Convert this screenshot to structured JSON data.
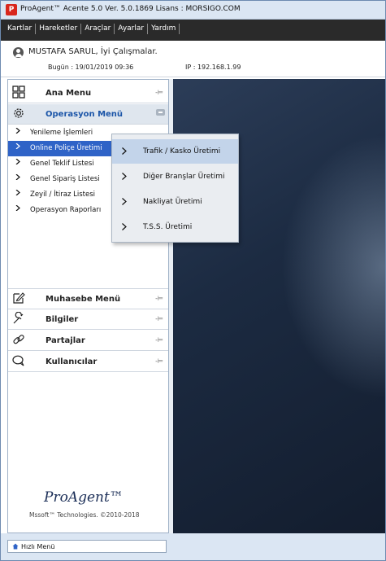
{
  "window": {
    "title": "ProAgent™ Acente 5.0  Ver. 5.0.1869    Lisans : MORSIGO.COM"
  },
  "menu": {
    "items": [
      "Kartlar",
      "Hareketler",
      "Araçlar",
      "Ayarlar",
      "Yardım"
    ]
  },
  "user": {
    "greeting": "MUSTAFA SARUL, İyi Çalışmalar.",
    "date": "Bugün : 19/01/2019  09:36",
    "ip": "IP : 192.168.1.99"
  },
  "sidebar": {
    "ana_menu": "Ana Menu",
    "operasyon": {
      "label": "Operasyon Menü",
      "items": [
        "Yenileme İşlemleri",
        "Online Poliçe Üretimi",
        "Genel Teklif Listesi",
        "Genel Sipariş Listesi",
        "Zeyil / İtiraz Listesi",
        "Operasyon Raporları"
      ],
      "selected": "Online Poliçe Üretimi"
    },
    "muhasebe": "Muhasebe Menü",
    "bilgiler": "Bilgiler",
    "partajlar": "Partajlar",
    "kullanicilar": "Kullanıcılar",
    "logo": "ProAgent™",
    "copyright": "Mssoft™ Technologies.  ©2010-2018"
  },
  "popup": {
    "items": [
      "Trafik / Kasko Üretimi",
      "Diğer Branşlar Üretimi",
      "Nakliyat Üretimi",
      "T.S.S. Üretimi"
    ],
    "selected": "Trafik / Kasko Üretimi"
  },
  "footer": {
    "quick_menu": "Hızlı Menü"
  },
  "colors": {
    "accent": "#2f63c7",
    "menubar": "#2a2a2a",
    "active_section": "#1b55a8"
  }
}
